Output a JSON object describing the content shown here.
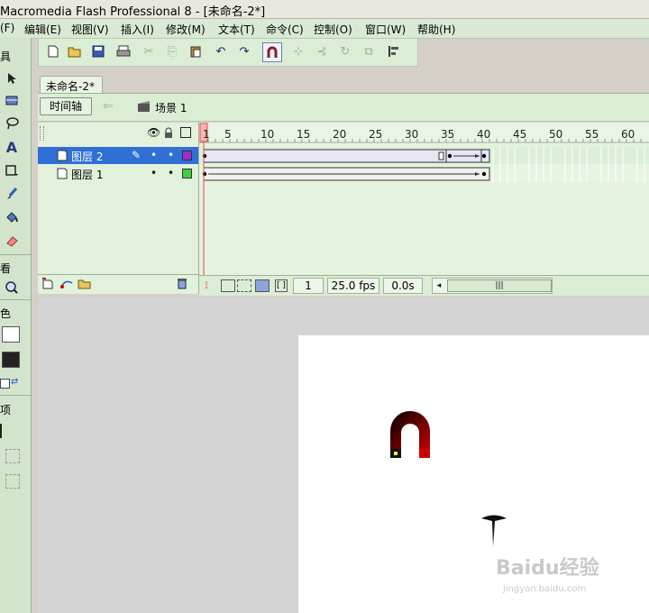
{
  "window": {
    "title": "Macromedia Flash Professional 8 - [未命名-2*]"
  },
  "menu": [
    {
      "label": "(F)"
    },
    {
      "label": "编辑(E)"
    },
    {
      "label": "视图(V)"
    },
    {
      "label": "插入(I)"
    },
    {
      "label": "修改(M)"
    },
    {
      "label": "文本(T)"
    },
    {
      "label": "命令(C)"
    },
    {
      "label": "控制(O)"
    },
    {
      "label": "窗口(W)"
    },
    {
      "label": "帮助(H)"
    }
  ],
  "tools_panel": {
    "header": "具",
    "view_label": "看",
    "color_label": "色",
    "options_label": "项"
  },
  "document": {
    "tab": "未命名-2*",
    "scene": "场景 1"
  },
  "timeline": {
    "button": "时间轴",
    "ruler": [
      "1",
      "5",
      "10",
      "15",
      "20",
      "25",
      "30",
      "35",
      "40",
      "45",
      "50",
      "55",
      "60"
    ],
    "layers": [
      {
        "name": "图层 2",
        "selected": true,
        "color": "#9a2fd0"
      },
      {
        "name": "图层 1",
        "selected": false,
        "color": "#3fd03f"
      }
    ],
    "current_frame": "1",
    "fps": "25.0 fps",
    "elapsed": "0.0s"
  },
  "watermark": {
    "brand": "Baidu经验",
    "url": "jingyan.baidu.com"
  },
  "colors": {
    "panel_green": "#d2e5cc",
    "selection": "#2f6fd6",
    "playhead": "#e84a4a"
  }
}
